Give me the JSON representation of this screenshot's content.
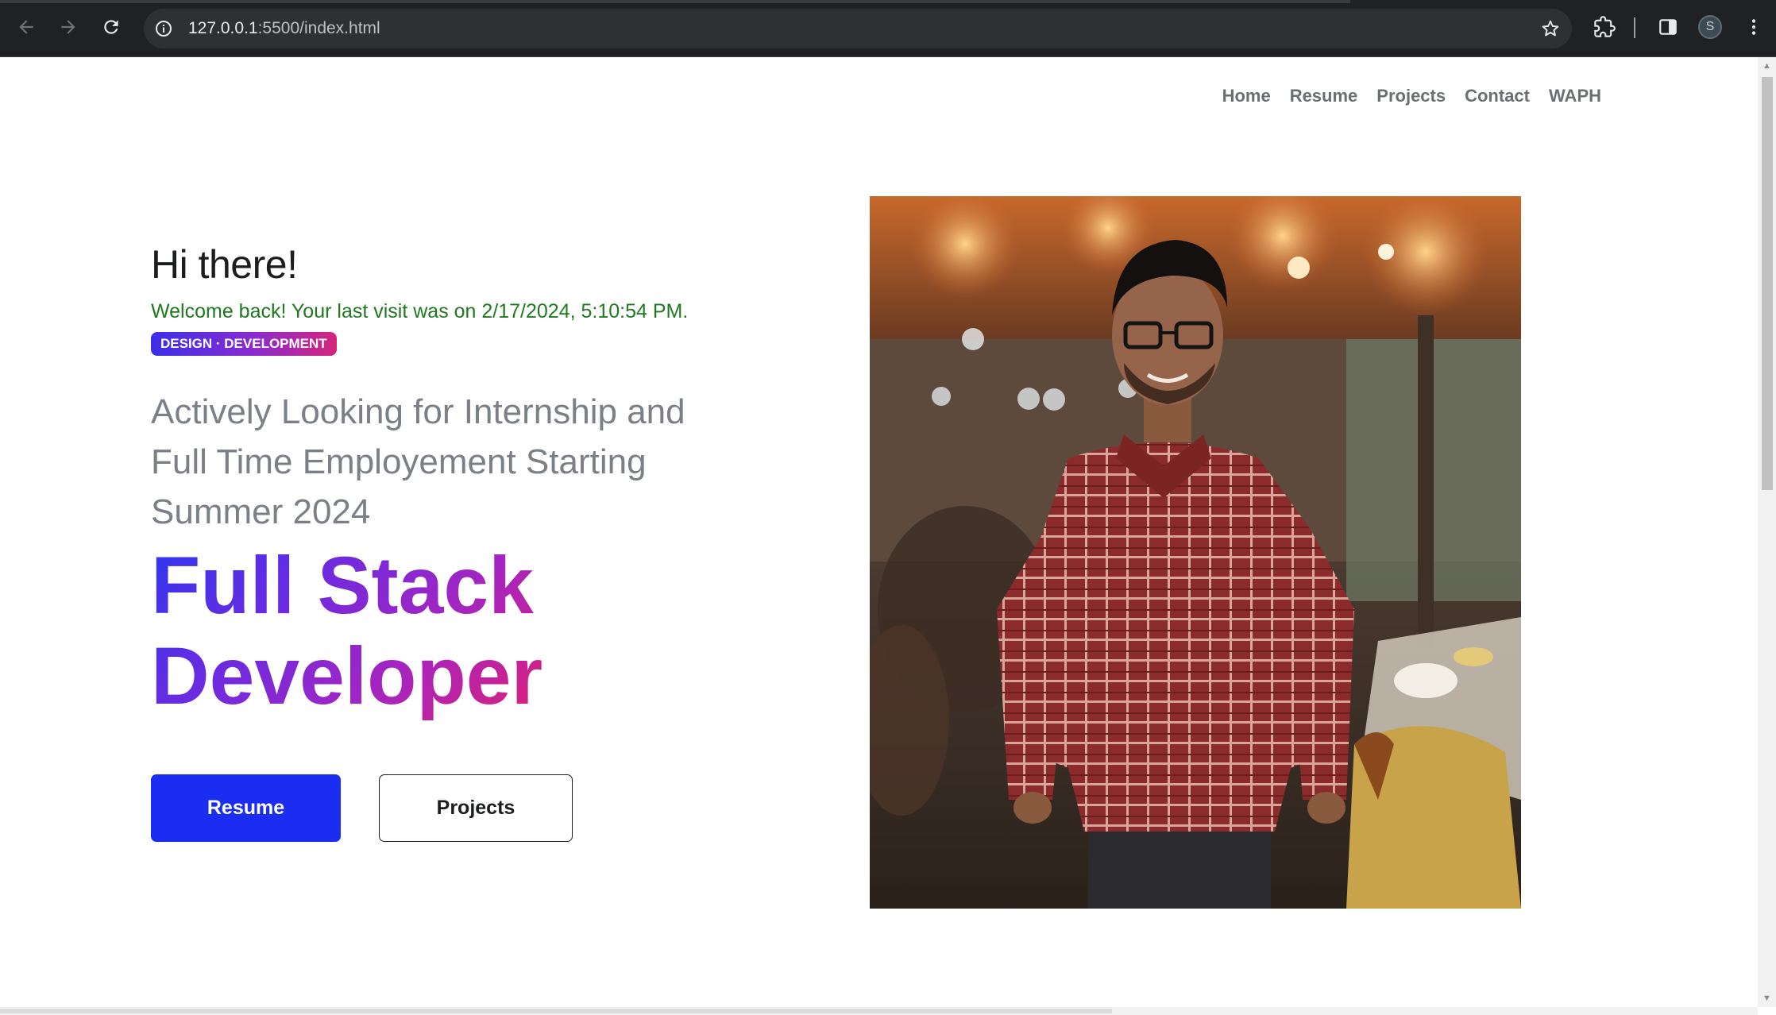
{
  "browser": {
    "url_host": "127.0.0.1",
    "url_rest": ":5500/index.html",
    "profile_initial": "S"
  },
  "nav": {
    "items": [
      "Home",
      "Resume",
      "Projects",
      "Contact",
      "WAPH"
    ]
  },
  "hero": {
    "greeting": "Hi there!",
    "welcome": "Welcome back! Your last visit was on 2/17/2024, 5:10:54 PM.",
    "badge": "DESIGN · DEVELOPMENT",
    "looking": "Actively Looking for Internship and Full Time Employement Starting Summer 2024",
    "role_line1": "Full Stack",
    "role_line2": "Developer",
    "primary_button": "Resume",
    "secondary_button": "Projects"
  },
  "colors": {
    "primary": "#1b2df0",
    "welcome_green": "#1f7a1f",
    "gradient_start": "#2e36f0",
    "gradient_end": "#dd2077"
  },
  "icons": {
    "back": "arrow-left-icon",
    "forward": "arrow-right-icon",
    "reload": "reload-icon",
    "site_info": "info-icon",
    "bookmark": "star-icon",
    "extensions": "puzzle-icon",
    "side_panel": "side-panel-icon",
    "menu": "kebab-menu-icon"
  }
}
